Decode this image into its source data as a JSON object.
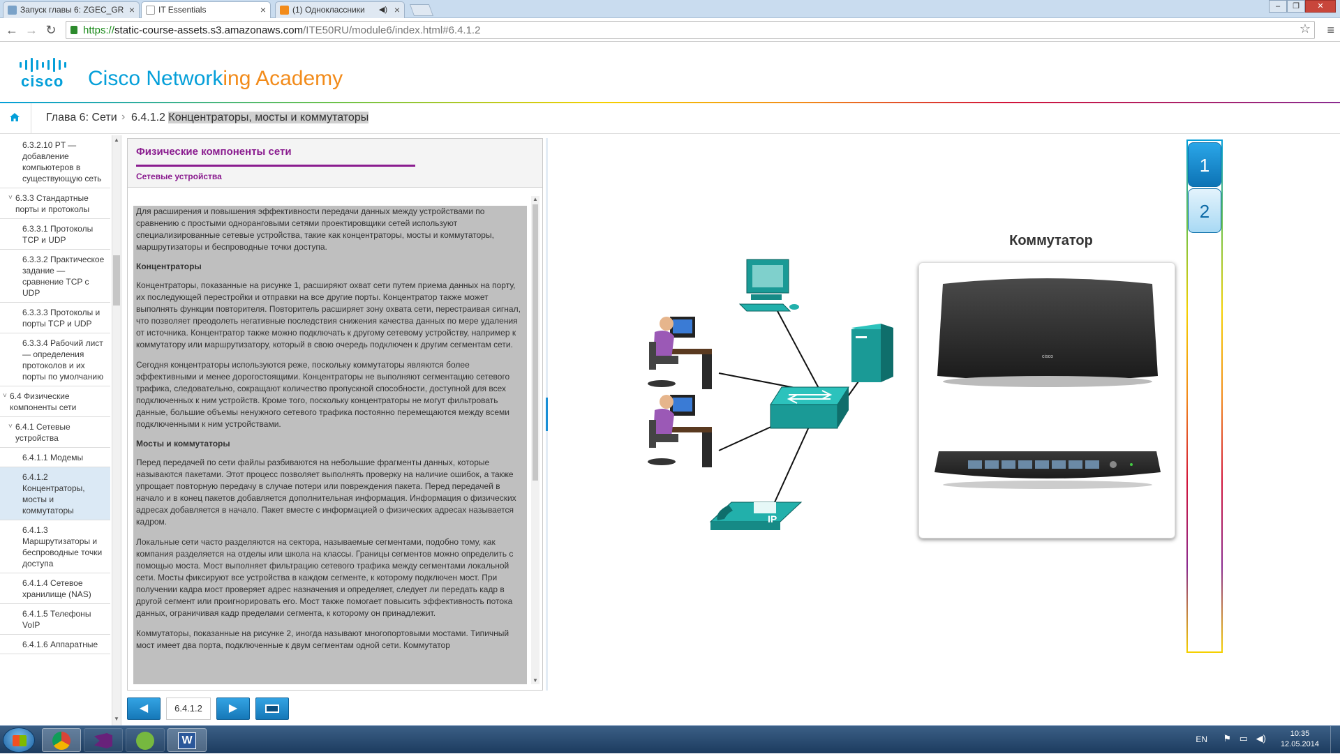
{
  "browser": {
    "tabs": [
      {
        "title": "Запуск главы 6: ZGEC_GR"
      },
      {
        "title": "IT Essentials"
      },
      {
        "title": "(1) Одноклассники"
      }
    ],
    "url_scheme": "https://",
    "url_host": "static-course-assets.s3.amazonaws.com",
    "url_path": "/ITE50RU/module6/index.html#6.4.1.2"
  },
  "brand": {
    "logo_text": "cisco",
    "title_part1": "Cisco Network",
    "title_part2": "ing Academy",
    "accent": "#049fd9"
  },
  "breadcrumb": {
    "chapter": "Глава 6: Сети",
    "section_num": "6.4.1.2",
    "section_title": "Концентраторы, мосты и коммутаторы"
  },
  "sidebar": {
    "items": [
      {
        "label": "6.3.2.10 PT — добавление компьютеров в существующую сеть",
        "level": 2
      },
      {
        "label": "6.3.3 Стандартные порты и протоколы",
        "level": 1,
        "chevron": "˅"
      },
      {
        "label": "6.3.3.1 Протоколы TCP и UDP",
        "level": 2
      },
      {
        "label": "6.3.3.2 Практическое задание — сравнение TCP с UDP",
        "level": 2
      },
      {
        "label": "6.3.3.3 Протоколы и порты TCP и UDP",
        "level": 2
      },
      {
        "label": "6.3.3.4 Рабочий лист — определения протоколов и их порты по умолчанию",
        "level": 2
      },
      {
        "label": "6.4 Физические компоненты сети",
        "level": 0,
        "chevron": "˅"
      },
      {
        "label": "6.4.1 Сетевые устройства",
        "level": 1,
        "chevron": "˅"
      },
      {
        "label": "6.4.1.1 Модемы",
        "level": 2
      },
      {
        "label": "6.4.1.2 Концентраторы, мосты и коммутаторы",
        "level": 2,
        "active": true
      },
      {
        "label": "6.4.1.3 Маршрутизаторы и беспроводные точки доступа",
        "level": 2
      },
      {
        "label": "6.4.1.4 Сетевое хранилище (NAS)",
        "level": 2
      },
      {
        "label": "6.4.1.5 Телефоны VoIP",
        "level": 2
      },
      {
        "label": "6.4.1.6 Аппаратные",
        "level": 2
      }
    ]
  },
  "panel": {
    "title": "Физические компоненты сети",
    "subtitle": "Сетевые устройства",
    "p1": "Для расширения и повышения эффективности передачи данных между устройствами по сравнению с простыми одноранговыми сетями проектировщики сетей используют специализированные сетевые устройства, такие как концентраторы, мосты и коммутаторы, маршрутизаторы и беспроводные точки доступа.",
    "h1": "Концентраторы",
    "p2": "Концентраторы, показанные на рисунке 1, расширяют охват сети путем приема данных на порту, их последующей перестройки и отправки на все другие порты. Концентратор также может выполнять функции повторителя. Повторитель расширяет зону охвата сети, перестраивая сигнал, что позволяет преодолеть негативные последствия снижения качества данных по мере удаления от источника. Концентратор также можно подключать к другому сетевому устройству, например к коммутатору или маршрутизатору, который в свою очередь подключен к другим сегментам сети.",
    "p3": "Сегодня концентраторы используются реже, поскольку коммутаторы являются более эффективными и менее дорогостоящими. Концентраторы не выполняют сегментацию сетевого трафика, следовательно, сокращают количество пропускной способности, доступной для всех подключенных к ним устройств. Кроме того, поскольку концентраторы не могут фильтровать данные, большие объемы ненужного сетевого трафика постоянно перемещаются между всеми подключенными к ним устройствами.",
    "h2": "Мосты и коммутаторы",
    "p4": "Перед передачей по сети файлы разбиваются на небольшие фрагменты данных, которые называются пакетами. Этот процесс позволяет выполнять проверку на наличие ошибок, а также упрощает повторную передачу в случае потери или повреждения пакета. Перед передачей в начало и в конец пакетов добавляется дополнительная информация. Информация о физических адресах добавляется в начало. Пакет вместе с информацией о физических адресах называется кадром.",
    "p5": "Локальные сети часто разделяются на сектора, называемые сегментами, подобно тому, как компания разделяется на отделы или школа на классы. Границы сегментов можно определить с помощью моста. Мост выполняет фильтрацию сетевого трафика между сегментами локальной сети. Мосты фиксируют все устройства в каждом сегменте, к которому подключен мост. При получении кадра мост проверяет адрес назначения и определяет, следует ли передать кадр в другой сегмент или проигнорировать его. Мост также помогает повысить эффективность потока данных, ограничивая кадр пределами сегмента, к которому он принадлежит.",
    "p6": "Коммутаторы, показанные на рисунке 2, иногда называют многопортовыми мостами. Типичный мост имеет два порта, подключенные к двум сегментам одной сети. Коммутатор"
  },
  "pager": {
    "page": "6.4.1.2"
  },
  "figure": {
    "photo_title": "Коммутатор",
    "ip_label": "IP",
    "device_brand": "cisco",
    "tabs": [
      "1",
      "2"
    ],
    "active_tab": "1"
  },
  "taskbar": {
    "lang": "EN",
    "time": "10:35",
    "date": "12.05.2014"
  }
}
